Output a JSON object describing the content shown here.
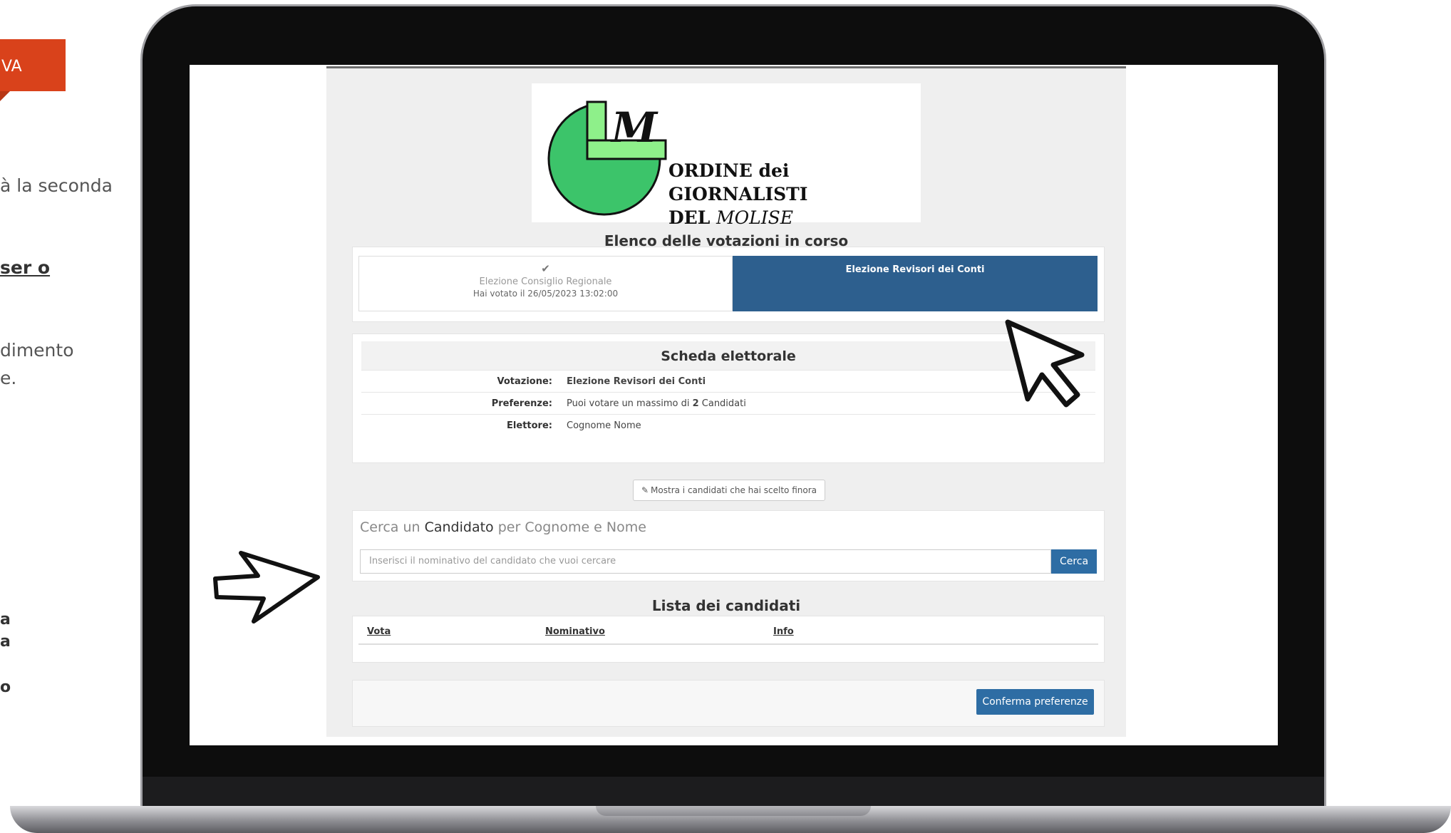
{
  "left_slide": {
    "tag": "VA",
    "lines": [
      "à la seconda",
      "ser o",
      "dimento",
      "e."
    ],
    "bold_lines": [
      "a",
      "a",
      "o"
    ]
  },
  "app": {
    "logo": {
      "letter": "M",
      "line1": "ORDINE dei GIORNALISTI",
      "line2_a": "DEL ",
      "line2_b": "MOLISE"
    },
    "votazioni_title": "Elenco delle votazioni in corso",
    "tabs": {
      "done_check": "✔",
      "done_name": "Elezione Consiglio Regionale",
      "done_status": "Hai votato il 26/05/2023 13:02:00",
      "active_name": "Elezione Revisori dei Conti"
    },
    "scheda": {
      "title": "Scheda elettorale",
      "votazione_label": "Votazione:",
      "votazione_value": "Elezione Revisori dei Conti",
      "preferenze_label": "Preferenze:",
      "preferenze_prefix": "Puoi votare un massimo di ",
      "preferenze_num": "2",
      "preferenze_suffix": " Candidati",
      "elettore_label": "Elettore:",
      "elettore_value": "Cognome Nome"
    },
    "show_button": "Mostra i candidati che hai scelto finora",
    "search": {
      "title_a": "Cerca un ",
      "title_b": "Candidato",
      "title_c": " per Cognome e Nome",
      "placeholder": "Inserisci il nominativo del candidato che vuoi cercare",
      "button": "Cerca"
    },
    "lista": {
      "title": "Lista dei candidati",
      "columns": [
        "Vota",
        "Nominativo",
        "Info"
      ]
    },
    "confirm_button": "Conferma preferenze"
  }
}
